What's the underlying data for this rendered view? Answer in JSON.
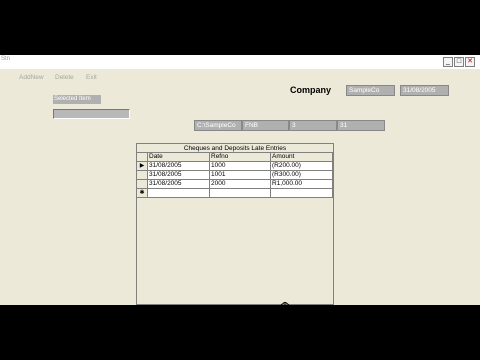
{
  "window": {
    "title": "Stn"
  },
  "title_buttons": {
    "minimize": "_",
    "maximize": "□",
    "close": "✕"
  },
  "menu": [
    "AddNew",
    "Delete",
    "Exit"
  ],
  "header": {
    "company_label": "Company",
    "company_value": "SampleCo",
    "date_value": "31/08/2005"
  },
  "selected_item_label": "Selected Item",
  "selected_item_value": "",
  "info_bar": [
    "C:\\SampleCo",
    "FNB",
    "3",
    "31"
  ],
  "grid": {
    "caption": "Cheques and Deposits Late Entries",
    "columns": [
      "Date",
      "Refno",
      "Amount"
    ],
    "rows": [
      {
        "indicator": "▶",
        "date": "31/08/2005",
        "refno": "1000",
        "amount": "(R200.00)"
      },
      {
        "indicator": "",
        "date": "31/08/2005",
        "refno": "1001",
        "amount": "(R300.00)"
      },
      {
        "indicator": "",
        "date": "31/08/2005",
        "refno": "2000",
        "amount": "R1,000.00"
      }
    ],
    "new_row_indicator": "✱"
  }
}
